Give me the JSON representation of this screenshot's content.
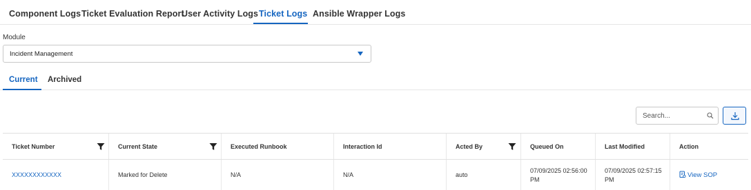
{
  "top_tabs": [
    {
      "label": "Component Logs",
      "active": false
    },
    {
      "label": "Ticket Evaluation Report",
      "active": false
    },
    {
      "label": "User Activity Logs",
      "active": false
    },
    {
      "label": "Ticket Logs",
      "active": true
    },
    {
      "label": "Ansible Wrapper Logs",
      "active": false
    }
  ],
  "module": {
    "label": "Module",
    "selected": "Incident Management"
  },
  "sub_tabs": [
    {
      "label": "Current",
      "active": true
    },
    {
      "label": "Archived",
      "active": false
    }
  ],
  "search": {
    "placeholder": "Search..."
  },
  "icons": {
    "search": "search-icon",
    "download": "download-icon",
    "filter": "filter-icon",
    "sop": "document-icon",
    "dropdown": "caret-down-icon"
  },
  "colors": {
    "accent": "#1565c0",
    "text": "#333333",
    "border": "#e0e0e0"
  },
  "table": {
    "columns": [
      {
        "label": "Ticket Number",
        "filterable": true
      },
      {
        "label": "Current State",
        "filterable": true
      },
      {
        "label": "Executed Runbook",
        "filterable": false
      },
      {
        "label": "Interaction Id",
        "filterable": false
      },
      {
        "label": "Acted By",
        "filterable": true
      },
      {
        "label": "Queued On",
        "filterable": false
      },
      {
        "label": "Last Modified",
        "filterable": false
      },
      {
        "label": "Action",
        "filterable": false
      }
    ],
    "rows": [
      {
        "ticket_number": "XXXXXXXXXXXX",
        "current_state": "Marked for Delete",
        "executed_runbook": "N/A",
        "interaction_id": "N/A",
        "acted_by": "auto",
        "queued_on": "07/09/2025 02:56:00 PM",
        "last_modified": "07/09/2025 02:57:15 PM",
        "action": "View SOP"
      }
    ]
  }
}
